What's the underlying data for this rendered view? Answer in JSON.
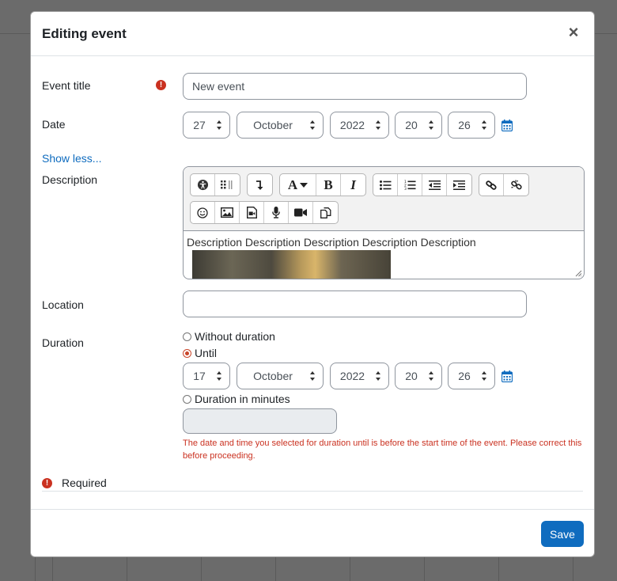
{
  "modal": {
    "title": "Editing event",
    "close_label": "×"
  },
  "form": {
    "event_title": {
      "label": "Event title",
      "value": "New event"
    },
    "date": {
      "label": "Date",
      "day": "27",
      "month": "October",
      "year": "2022",
      "hour": "20",
      "minute": "26"
    },
    "show_less": "Show less...",
    "description": {
      "label": "Description",
      "content": "Description Description Description Description Description"
    },
    "location": {
      "label": "Location",
      "value": ""
    },
    "duration": {
      "label": "Duration",
      "options": [
        {
          "label": "Without duration",
          "checked": false
        },
        {
          "label": "Until",
          "checked": true
        },
        {
          "label": "Duration in minutes",
          "checked": false
        }
      ],
      "until": {
        "day": "17",
        "month": "October",
        "year": "2022",
        "hour": "20",
        "minute": "26"
      },
      "minutes_value": "",
      "error": "The date and time you selected for duration until is before the start time of the event. Please correct this before proceeding."
    },
    "required_label": "Required"
  },
  "toolbar": {
    "row1": [
      "accessibility-checker-icon",
      "screenreader-helper-icon",
      "line-break-icon",
      "font-color-icon",
      "bold-icon",
      "italic-icon",
      "unordered-list-icon",
      "ordered-list-icon",
      "outdent-icon",
      "indent-icon",
      "link-icon",
      "unlink-icon"
    ],
    "row2": [
      "emoji-icon",
      "image-icon",
      "media-icon",
      "record-audio-icon",
      "record-video-icon",
      "manage-files-icon"
    ],
    "bold_glyph": "B",
    "italic_glyph": "I",
    "font_glyph": "A"
  },
  "footer": {
    "save_label": "Save"
  },
  "colors": {
    "primary": "#0f6cbf",
    "danger": "#ca3120"
  }
}
